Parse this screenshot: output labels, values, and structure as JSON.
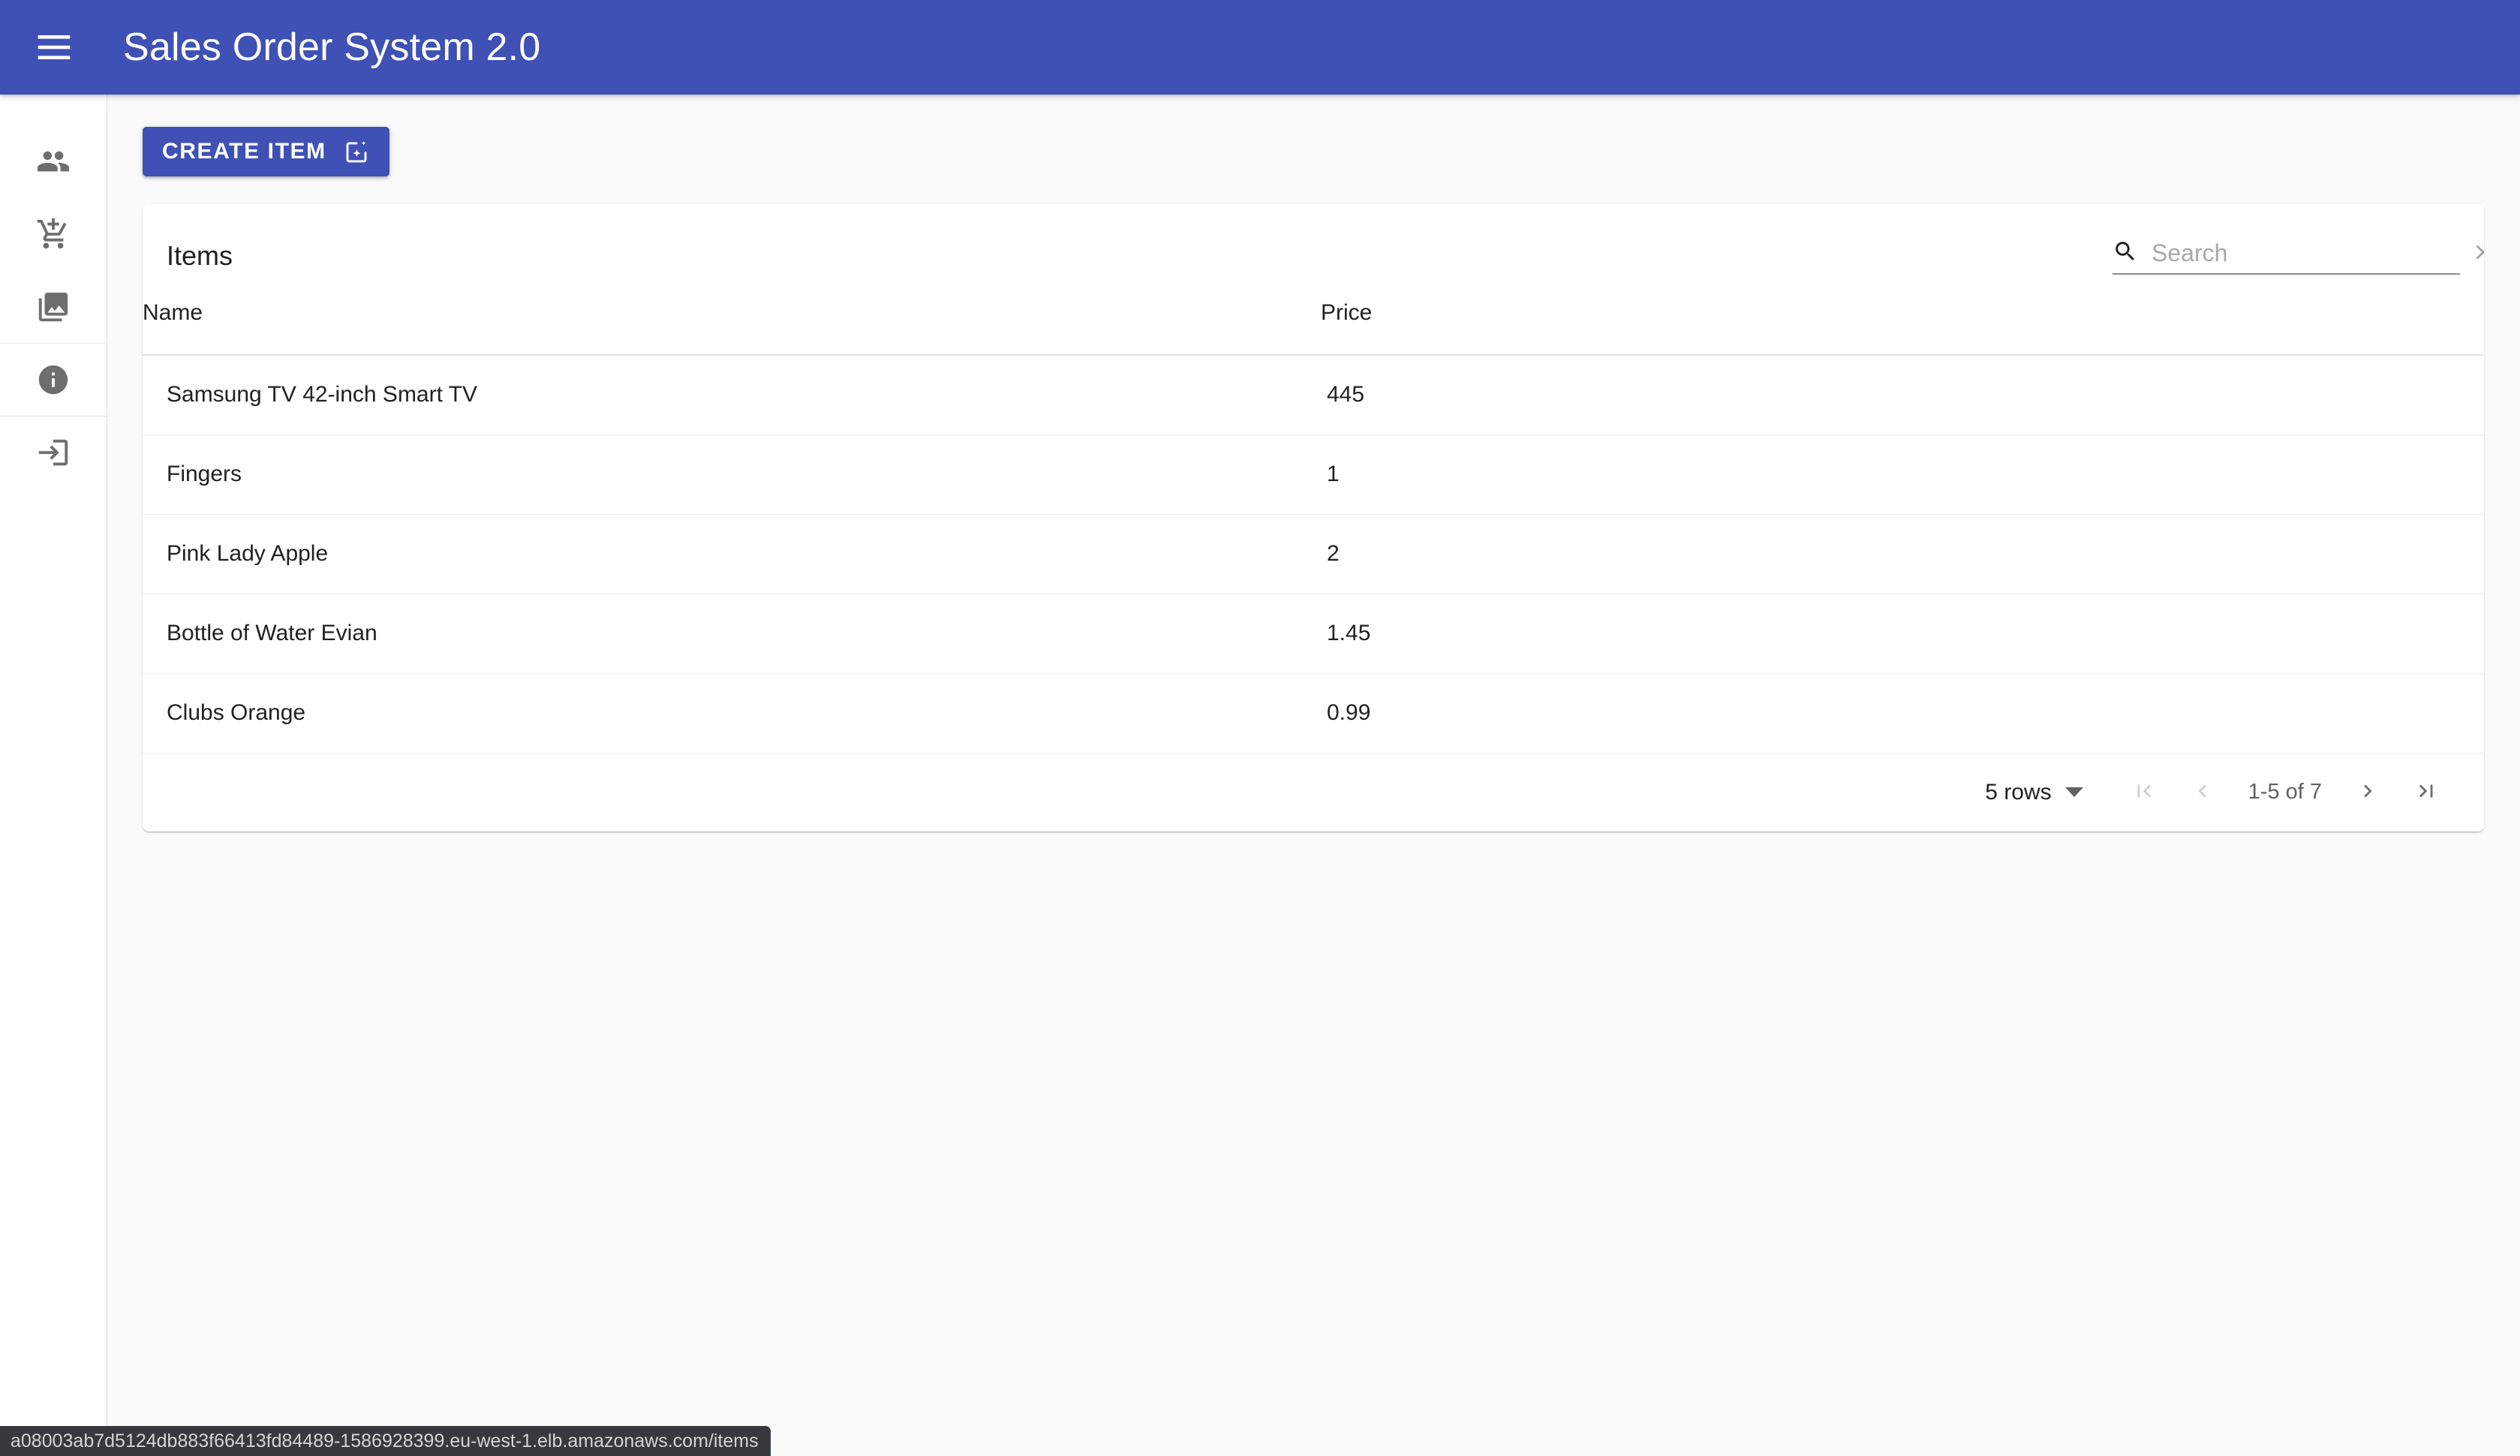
{
  "appbar": {
    "title": "Sales Order System 2.0",
    "menu_icon": "hamburger-menu-icon",
    "background_color": "#3f51b5"
  },
  "sidebar": {
    "items": [
      {
        "icon": "people-icon",
        "name": "customers"
      },
      {
        "icon": "add-shopping-cart-icon",
        "name": "orders"
      },
      {
        "icon": "photo-library-icon",
        "name": "items"
      },
      {
        "icon": "info-icon",
        "name": "about"
      },
      {
        "icon": "login-icon",
        "name": "login"
      }
    ]
  },
  "toolbar": {
    "create_label": "CREATE ITEM",
    "create_icon": "add-to-photos-sparkle-icon"
  },
  "card": {
    "title": "Items"
  },
  "search": {
    "placeholder": "Search",
    "value": "",
    "search_icon": "search-icon",
    "clear_icon": "close-icon"
  },
  "table": {
    "columns": [
      "Name",
      "Price"
    ],
    "rows": [
      {
        "name": "Samsung TV 42-inch Smart TV",
        "price": "445"
      },
      {
        "name": "Fingers",
        "price": "1"
      },
      {
        "name": "Pink Lady Apple",
        "price": "2"
      },
      {
        "name": "Bottle of Water Evian",
        "price": "1.45"
      },
      {
        "name": "Clubs Orange",
        "price": "0.99"
      }
    ]
  },
  "pagination": {
    "rows_per_page_label": "5 rows",
    "range_label": "1-5 of 7",
    "first_page_icon": "first-page-icon",
    "prev_page_icon": "chevron-left-icon",
    "next_page_icon": "chevron-right-icon",
    "last_page_icon": "last-page-icon",
    "first_enabled": false,
    "prev_enabled": false,
    "next_enabled": true,
    "last_enabled": true
  },
  "statusbar": {
    "url": "a08003ab7d5124db883f66413fd84489-1586928399.eu-west-1.elb.amazonaws.com/items"
  }
}
